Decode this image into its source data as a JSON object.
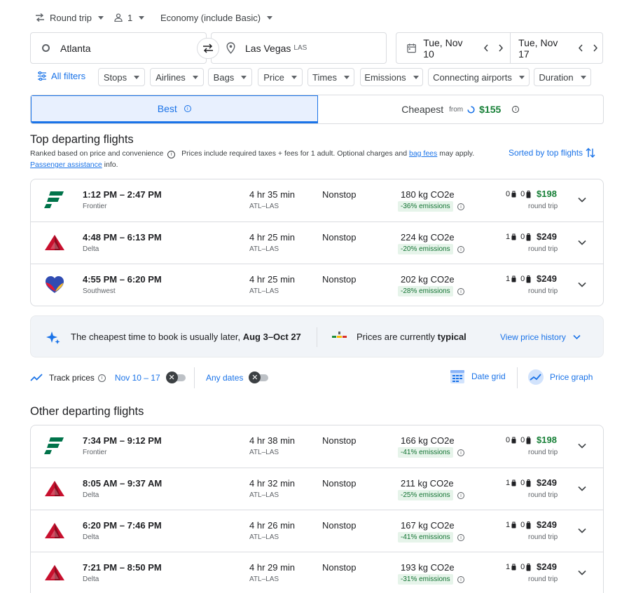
{
  "search": {
    "trip_type": "Round trip",
    "passengers": "1",
    "cabin": "Economy (include Basic)",
    "origin": "Atlanta",
    "destination": "Las Vegas",
    "destination_code": "LAS",
    "depart_date": "Tue, Nov 10",
    "return_date": "Tue, Nov 17"
  },
  "filters": {
    "all_filters": "All filters",
    "chips": [
      "Stops",
      "Airlines",
      "Bags",
      "Price",
      "Times",
      "Emissions",
      "Connecting airports",
      "Duration"
    ]
  },
  "tabs": {
    "best": "Best",
    "cheapest": "Cheapest",
    "cheapest_from": "from",
    "cheapest_price": "$155"
  },
  "top": {
    "title": "Top departing flights",
    "ranked": "Ranked based on price and convenience",
    "prices_note_1": "Prices include required taxes + fees for 1 adult. Optional charges and",
    "bag_fees": "bag fees",
    "prices_note_2": "may apply.",
    "passenger_assistance": "Passenger assistance",
    "info": "info.",
    "sorted": "Sorted by top flights"
  },
  "top_flights": [
    {
      "airline": "frontier",
      "times": "1:12 PM – 2:47 PM",
      "carrier": "Frontier",
      "duration": "4 hr 35 min",
      "route": "ATL–LAS",
      "stops": "Nonstop",
      "co2": "180 kg CO2e",
      "emissions": "-36% emissions",
      "carry": "0",
      "checked": "0",
      "price": "$198",
      "cheap": true,
      "price_type": "round trip"
    },
    {
      "airline": "delta",
      "times": "4:48 PM – 6:13 PM",
      "carrier": "Delta",
      "duration": "4 hr 25 min",
      "route": "ATL–LAS",
      "stops": "Nonstop",
      "co2": "224 kg CO2e",
      "emissions": "-20% emissions",
      "carry": "1",
      "checked": "0",
      "price": "$249",
      "cheap": false,
      "price_type": "round trip"
    },
    {
      "airline": "southwest",
      "times": "4:55 PM – 6:20 PM",
      "carrier": "Southwest",
      "duration": "4 hr 25 min",
      "route": "ATL–LAS",
      "stops": "Nonstop",
      "co2": "202 kg CO2e",
      "emissions": "-28% emissions",
      "carry": "1",
      "checked": "0",
      "price": "$249",
      "cheap": false,
      "price_type": "round trip"
    }
  ],
  "insights": {
    "book_text": "The cheapest time to book is usually later,",
    "book_range": "Aug 3–Oct 27",
    "prices_text": "Prices are currently",
    "prices_level": "typical",
    "history_link": "View price history"
  },
  "tracking": {
    "track_prices": "Track prices",
    "dates": "Nov 10 – 17",
    "any_dates": "Any dates",
    "date_grid": "Date grid",
    "price_graph": "Price graph"
  },
  "other": {
    "title": "Other departing flights"
  },
  "other_flights": [
    {
      "airline": "frontier",
      "times": "7:34 PM – 9:12 PM",
      "carrier": "Frontier",
      "duration": "4 hr 38 min",
      "route": "ATL–LAS",
      "stops": "Nonstop",
      "co2": "166 kg CO2e",
      "emissions": "-41% emissions",
      "carry": "0",
      "checked": "0",
      "price": "$198",
      "cheap": true,
      "price_type": "round trip"
    },
    {
      "airline": "delta",
      "times": "8:05 AM – 9:37 AM",
      "carrier": "Delta",
      "duration": "4 hr 32 min",
      "route": "ATL–LAS",
      "stops": "Nonstop",
      "co2": "211 kg CO2e",
      "emissions": "-25% emissions",
      "carry": "1",
      "checked": "0",
      "price": "$249",
      "cheap": false,
      "price_type": "round trip"
    },
    {
      "airline": "delta",
      "times": "6:20 PM – 7:46 PM",
      "carrier": "Delta",
      "duration": "4 hr 26 min",
      "route": "ATL–LAS",
      "stops": "Nonstop",
      "co2": "167 kg CO2e",
      "emissions": "-41% emissions",
      "carry": "1",
      "checked": "0",
      "price": "$249",
      "cheap": false,
      "price_type": "round trip"
    },
    {
      "airline": "delta",
      "times": "7:21 PM – 8:50 PM",
      "carrier": "Delta",
      "duration": "4 hr 29 min",
      "route": "ATL–LAS",
      "stops": "Nonstop",
      "co2": "193 kg CO2e",
      "emissions": "-31% emissions",
      "carry": "1",
      "checked": "0",
      "price": "$249",
      "cheap": false,
      "price_type": "round trip"
    }
  ],
  "colors": {
    "accent": "#1a73e8",
    "price_green": "#188038",
    "frontier": "#00734a",
    "delta": "#c8102e",
    "southwest_blue": "#304cb2",
    "southwest_red": "#e31837",
    "southwest_yellow": "#ffbf27"
  }
}
